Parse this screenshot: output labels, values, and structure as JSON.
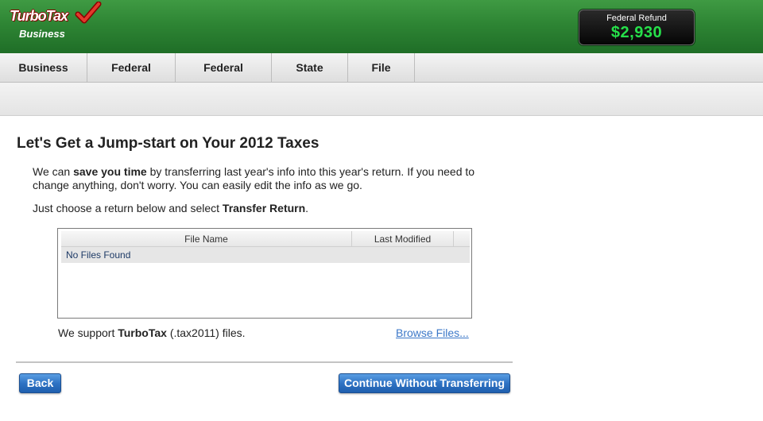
{
  "header": {
    "logo_main": "TurboTax",
    "logo_sub": "Business",
    "refund_label": "Federal Refund",
    "refund_amount": "$2,930"
  },
  "nav": {
    "tabs": [
      {
        "label": "Business Info"
      },
      {
        "label": "Federal Taxes"
      },
      {
        "label": "Federal Review"
      },
      {
        "label": "State Taxes"
      },
      {
        "label": "File"
      }
    ]
  },
  "main": {
    "title": "Let's Get a Jump-start on Your 2012 Taxes",
    "intro": {
      "part1": "We can ",
      "bold1": "save you time",
      "part2": " by transferring last year's info into this year's return. If you need to change anything, don't worry. You can easily edit the info as we go."
    },
    "instruction": {
      "part1": "Just choose a return below and select ",
      "bold": "Transfer Return",
      "part2": "."
    },
    "file_table": {
      "columns": [
        "File Name",
        "Last Modified"
      ],
      "empty_text": "No Files Found"
    },
    "support": {
      "part1": "We support ",
      "bold": "TurboTax",
      "part2": " (.tax2011) files."
    },
    "browse_label": "Browse Files..."
  },
  "footer": {
    "back_label": "Back",
    "continue_label": "Continue Without Transferring"
  },
  "colors": {
    "header_green": "#2e8534",
    "refund_green": "#26e04a",
    "button_blue": "#2f73c4",
    "link_blue": "#3c78c8"
  }
}
